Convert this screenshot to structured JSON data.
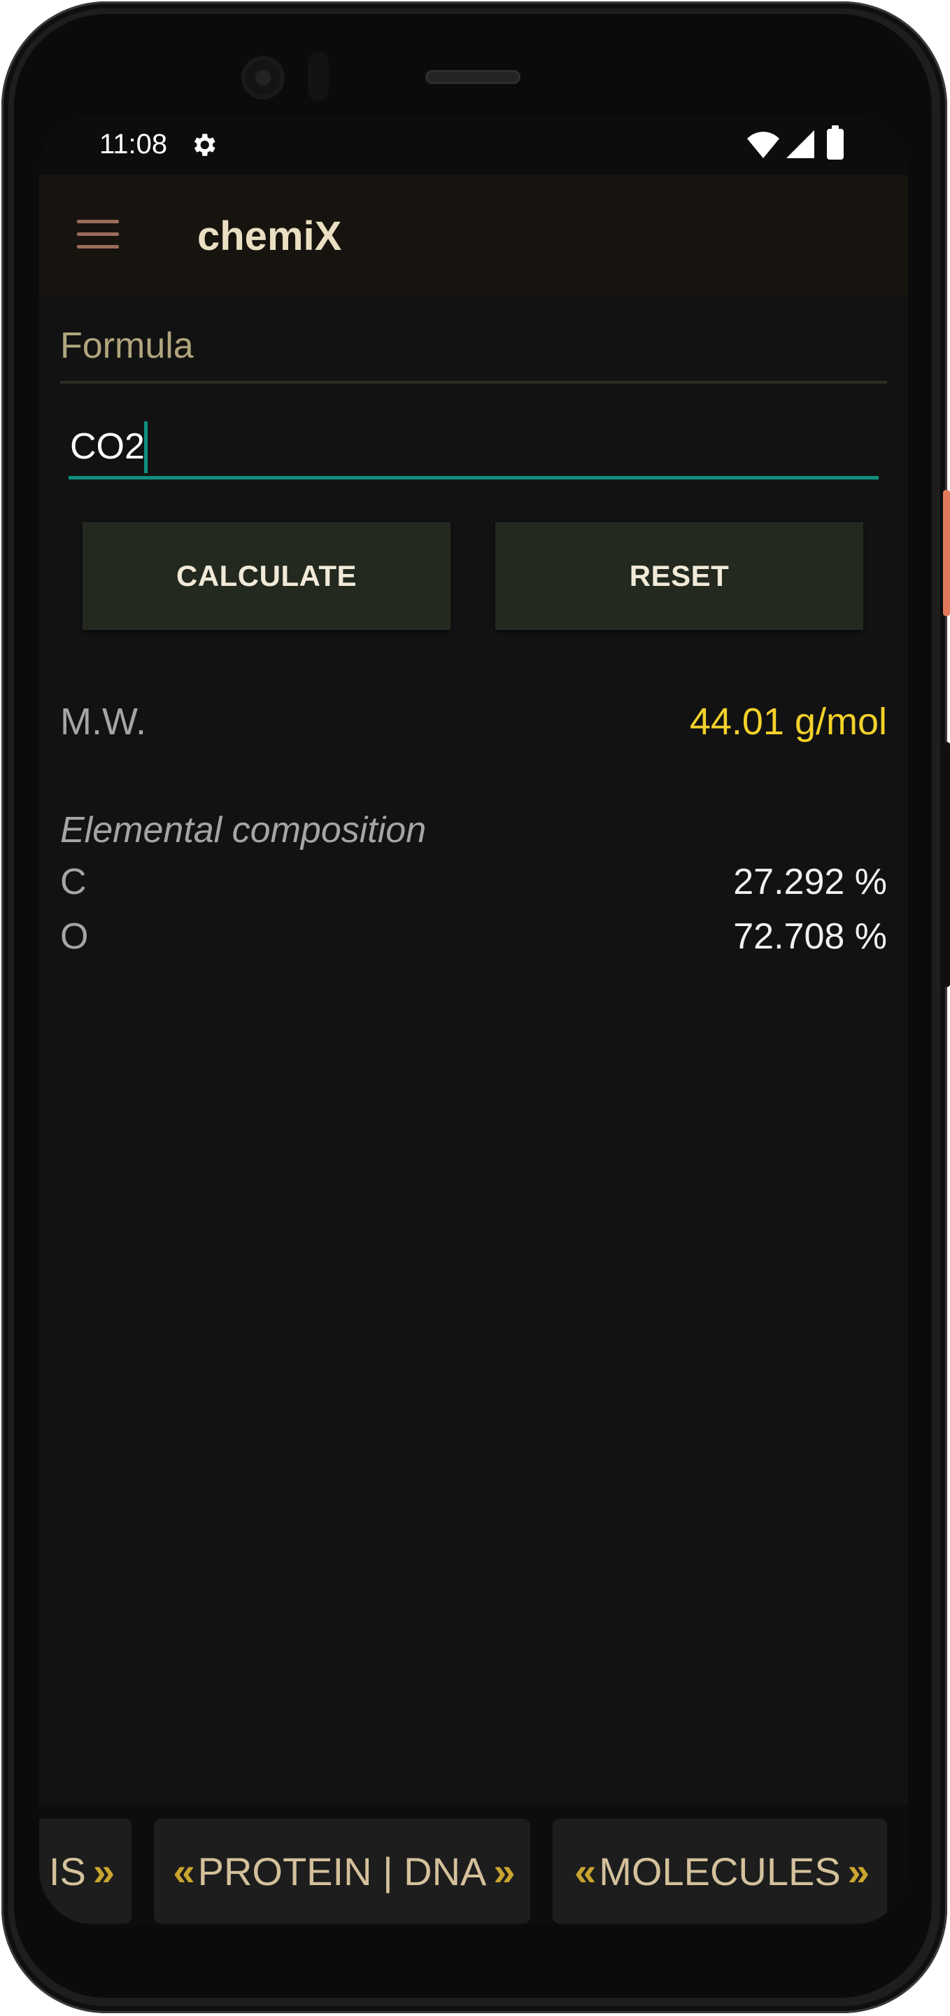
{
  "status_bar": {
    "time": "11:08",
    "settings_icon": "gear-icon",
    "wifi_icon": "wifi-icon",
    "signal_icon": "signal-icon",
    "battery_icon": "battery-icon"
  },
  "app_bar": {
    "menu_icon": "hamburger-menu-icon",
    "title": "chemiX"
  },
  "formula": {
    "label": "Formula",
    "value": "CO2",
    "placeholder": ""
  },
  "buttons": {
    "calculate": "CALCULATE",
    "reset": "RESET"
  },
  "result": {
    "mw_label": "M.W.",
    "mw_value": "44.01 g/mol"
  },
  "composition": {
    "title": "Elemental composition",
    "rows": [
      {
        "element": "C",
        "percent": "27.292 %"
      },
      {
        "element": "O",
        "percent": "72.708 %"
      }
    ]
  },
  "bottom_tabs": [
    {
      "label": "IS"
    },
    {
      "label": "PROTEIN | DNA"
    },
    {
      "label": "MOLECULES"
    }
  ],
  "colors": {
    "accent_teal": "#0e8f80",
    "mw_value_yellow": "#f3d12a",
    "chevron_gold": "#c9a42f",
    "button_bg": "#23291f",
    "screen_bg": "#121212"
  }
}
